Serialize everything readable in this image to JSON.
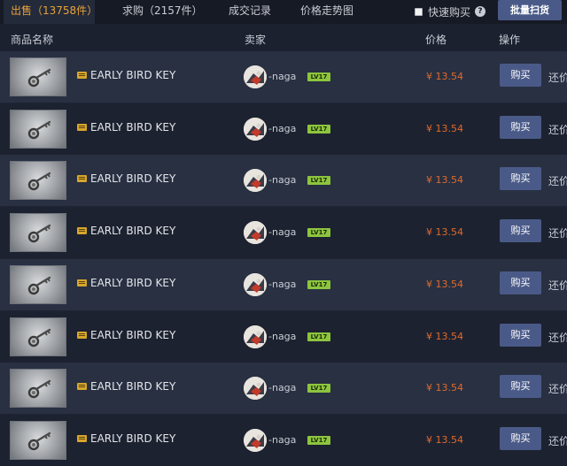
{
  "tabs": [
    {
      "label": "出售（13758件）",
      "active": true
    },
    {
      "label": "求购（2157件）",
      "active": false
    },
    {
      "label": "成交记录",
      "active": false
    },
    {
      "label": "价格走势图",
      "active": false
    }
  ],
  "quick_buy": {
    "label": "快速购买",
    "help": "?",
    "checked": false
  },
  "bulk_button": "批量扫货",
  "columns": {
    "item": "商品名称",
    "seller": "卖家",
    "price": "价格",
    "action": "操作"
  },
  "colors": {
    "accent": "#e8a238",
    "price": "#e06a2c",
    "button": "#4a5a88",
    "level": "#8dc53e"
  },
  "rows": [
    {
      "name": "EARLY BIRD KEY",
      "seller": "-naga",
      "level": "LV17",
      "price": "¥ 13.54",
      "buy_label": "购买",
      "counter": "还价",
      "icon": "key-item-icon"
    },
    {
      "name": "EARLY BIRD KEY",
      "seller": "-naga",
      "level": "LV17",
      "price": "¥ 13.54",
      "buy_label": "购买",
      "counter": "还价",
      "icon": "key-item-icon"
    },
    {
      "name": "EARLY BIRD KEY",
      "seller": "-naga",
      "level": "LV17",
      "price": "¥ 13.54",
      "buy_label": "购买",
      "counter": "还价",
      "icon": "key-item-icon"
    },
    {
      "name": "EARLY BIRD KEY",
      "seller": "-naga",
      "level": "LV17",
      "price": "¥ 13.54",
      "buy_label": "购买",
      "counter": "还价",
      "icon": "key-item-icon"
    },
    {
      "name": "EARLY BIRD KEY",
      "seller": "-naga",
      "level": "LV17",
      "price": "¥ 13.54",
      "buy_label": "购买",
      "counter": "还价",
      "icon": "key-item-icon"
    },
    {
      "name": "EARLY BIRD KEY",
      "seller": "-naga",
      "level": "LV17",
      "price": "¥ 13.54",
      "buy_label": "购买",
      "counter": "还价",
      "icon": "key-item-icon"
    },
    {
      "name": "EARLY BIRD KEY",
      "seller": "-naga",
      "level": "LV17",
      "price": "¥ 13.54",
      "buy_label": "购买",
      "counter": "还价",
      "icon": "key-item-icon"
    },
    {
      "name": "EARLY BIRD KEY",
      "seller": "-naga",
      "level": "LV17",
      "price": "¥ 13.54",
      "buy_label": "购买",
      "counter": "还价",
      "icon": "key-item-icon"
    }
  ]
}
